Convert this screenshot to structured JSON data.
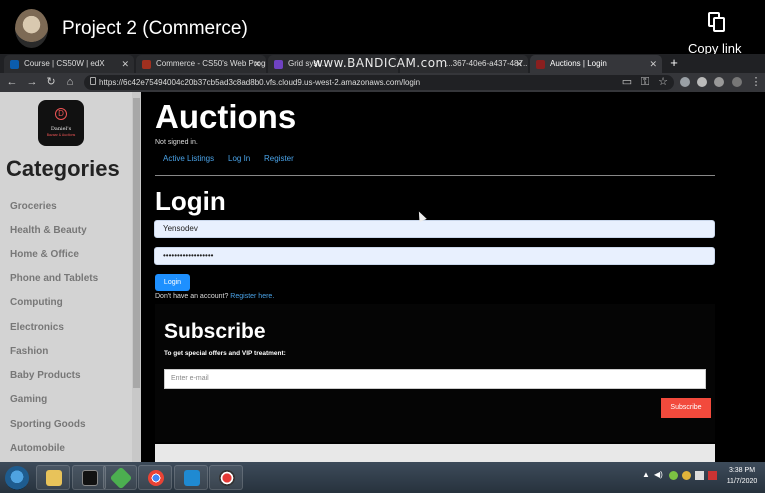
{
  "video": {
    "title": "Project 2 (Commerce)",
    "copy_label": "Copy link"
  },
  "browser": {
    "tabs": [
      {
        "label": "Course | CS50W | edX",
        "favicon_color": "#0b5cad"
      },
      {
        "label": "Commerce - CS50's Web Progr...",
        "favicon_color": "#a0301f"
      },
      {
        "label": "Grid syst...",
        "favicon_color": "#6f42c1"
      },
      {
        "label": "...367-40e6-a437-487...",
        "favicon_color": "#555555"
      },
      {
        "label": "Auctions | Login",
        "favicon_color": "#8a1f1f"
      }
    ],
    "watermark": "www.BANDICAM.com",
    "new_tab": "+",
    "url": "https://6c42e75494004c20b37cb5ad3c8ad8b0.vfs.cloud9.us-west-2.amazonaws.com/login"
  },
  "sidebar": {
    "logo_letter": "D",
    "logo_title": "Daniel's",
    "logo_subtitle": "Bazaar & Auctions",
    "heading": "Categories",
    "items": [
      "Groceries",
      "Health & Beauty",
      "Home & Office",
      "Phone and Tablets",
      "Computing",
      "Electronics",
      "Fashion",
      "Baby Products",
      "Gaming",
      "Sporting Goods",
      "Automobile"
    ]
  },
  "main": {
    "site_title": "Auctions",
    "status": "Not signed in.",
    "nav": [
      "Active Listings",
      "Log In",
      "Register"
    ],
    "login_heading": "Login",
    "username_value": "Yensodev",
    "password_value": "••••••••••••••••••",
    "login_button": "Login",
    "no_account": "Don't have an account?",
    "register_link": "Register here."
  },
  "subscribe": {
    "heading": "Subscribe",
    "text": "To get special offers and VIP treatment:",
    "email_placeholder": "Enter e-mail",
    "button": "Subscribe"
  },
  "taskbar": {
    "time": "3:38 PM",
    "date": "11/7/2020"
  }
}
